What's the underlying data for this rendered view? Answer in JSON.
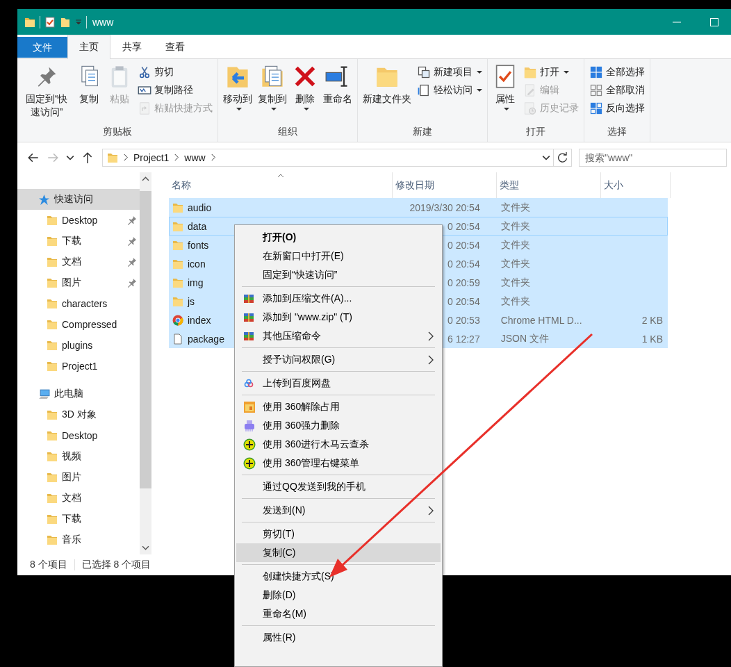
{
  "window": {
    "title": "www"
  },
  "ribbon_tabs": [
    {
      "label": "文件",
      "kind": "file",
      "selected": false
    },
    {
      "label": "主页",
      "kind": "tab",
      "selected": true
    },
    {
      "label": "共享",
      "kind": "tab",
      "selected": false
    },
    {
      "label": "查看",
      "kind": "tab",
      "selected": false
    }
  ],
  "ribbon_groups": [
    {
      "label": "剪贴板",
      "commands": [
        {
          "label": "固定到“快速访问”",
          "kind": "large",
          "disabled": false,
          "dropdown": false
        },
        {
          "label": "复制",
          "kind": "large",
          "disabled": false,
          "dropdown": false
        },
        {
          "label": "粘贴",
          "kind": "large",
          "disabled": true,
          "dropdown": false
        },
        {
          "label": "剪切",
          "kind": "small",
          "disabled": false,
          "dropdown": false
        },
        {
          "label": "复制路径",
          "kind": "small",
          "disabled": false,
          "dropdown": false
        },
        {
          "label": "粘贴快捷方式",
          "kind": "small",
          "disabled": true,
          "dropdown": false
        }
      ]
    },
    {
      "label": "组织",
      "commands": [
        {
          "label": "移动到",
          "kind": "large",
          "disabled": false,
          "dropdown": true
        },
        {
          "label": "复制到",
          "kind": "large",
          "disabled": false,
          "dropdown": true
        },
        {
          "label": "删除",
          "kind": "large",
          "disabled": false,
          "dropdown": true
        },
        {
          "label": "重命名",
          "kind": "large",
          "disabled": false,
          "dropdown": false
        }
      ]
    },
    {
      "label": "新建",
      "commands": [
        {
          "label": "新建文件夹",
          "kind": "large",
          "disabled": false,
          "dropdown": false
        },
        {
          "label": "新建项目",
          "kind": "small",
          "disabled": false,
          "dropdown": true
        },
        {
          "label": "轻松访问",
          "kind": "small",
          "disabled": false,
          "dropdown": true
        }
      ]
    },
    {
      "label": "打开",
      "commands": [
        {
          "label": "属性",
          "kind": "large",
          "disabled": false,
          "dropdown": true
        },
        {
          "label": "打开",
          "kind": "small",
          "disabled": false,
          "dropdown": true
        },
        {
          "label": "编辑",
          "kind": "small",
          "disabled": true,
          "dropdown": false
        },
        {
          "label": "历史记录",
          "kind": "small",
          "disabled": true,
          "dropdown": false
        }
      ]
    },
    {
      "label": "选择",
      "commands": [
        {
          "label": "全部选择",
          "kind": "small",
          "disabled": false,
          "dropdown": false
        },
        {
          "label": "全部取消",
          "kind": "small",
          "disabled": false,
          "dropdown": false
        },
        {
          "label": "反向选择",
          "kind": "small",
          "disabled": false,
          "dropdown": false
        }
      ]
    }
  ],
  "address_bar": {
    "breadcrumbs": [
      "Project1",
      "www"
    ],
    "search": {
      "placeholder": "搜索\"www\""
    }
  },
  "navigation": [
    {
      "label": "快速访问",
      "selected": true,
      "children": [
        {
          "label": "Desktop",
          "pinned": true,
          "selected": false
        },
        {
          "label": "下载",
          "pinned": true,
          "selected": false
        },
        {
          "label": "文档",
          "pinned": true,
          "selected": false
        },
        {
          "label": "图片",
          "pinned": true,
          "selected": false
        },
        {
          "label": "characters",
          "pinned": false,
          "selected": false
        },
        {
          "label": "Compressed",
          "pinned": false,
          "selected": false
        },
        {
          "label": "plugins",
          "pinned": false,
          "selected": false
        },
        {
          "label": "Project1",
          "pinned": false,
          "selected": false
        }
      ]
    },
    {
      "label": "此电脑",
      "selected": false,
      "children": [
        {
          "label": "3D 对象",
          "pinned": false,
          "selected": false
        },
        {
          "label": "Desktop",
          "pinned": false,
          "selected": false
        },
        {
          "label": "视频",
          "pinned": false,
          "selected": false
        },
        {
          "label": "图片",
          "pinned": false,
          "selected": false
        },
        {
          "label": "文档",
          "pinned": false,
          "selected": false
        },
        {
          "label": "下载",
          "pinned": false,
          "selected": false
        },
        {
          "label": "音乐",
          "pinned": false,
          "selected": false
        }
      ]
    }
  ],
  "file_list": {
    "columns": [
      {
        "label": "名称",
        "sorted": true
      },
      {
        "label": "修改日期",
        "sorted": false
      },
      {
        "label": "类型",
        "sorted": false
      },
      {
        "label": "大小",
        "sorted": false
      }
    ],
    "rows": [
      {
        "kind": "folder",
        "name": "audio",
        "date": "2019/3/30 20:54",
        "type": "文件夹",
        "size": "",
        "selected": true,
        "focused": false
      },
      {
        "kind": "folder",
        "name": "data",
        "date": "0 20:54",
        "type": "文件夹",
        "size": "",
        "selected": true,
        "focused": true
      },
      {
        "kind": "folder",
        "name": "fonts",
        "date": "0 20:54",
        "type": "文件夹",
        "size": "",
        "selected": true,
        "focused": false
      },
      {
        "kind": "folder",
        "name": "icon",
        "date": "0 20:54",
        "type": "文件夹",
        "size": "",
        "selected": true,
        "focused": false
      },
      {
        "kind": "folder",
        "name": "img",
        "date": "0 20:59",
        "type": "文件夹",
        "size": "",
        "selected": true,
        "focused": false
      },
      {
        "kind": "folder",
        "name": "js",
        "date": "0 20:54",
        "type": "文件夹",
        "size": "",
        "selected": true,
        "focused": false
      },
      {
        "kind": "chrome",
        "name": "index",
        "date": "0 20:53",
        "type": "Chrome HTML D...",
        "size": "2 KB",
        "selected": true,
        "focused": false
      },
      {
        "kind": "file",
        "name": "package",
        "date": "6 12:27",
        "type": "JSON 文件",
        "size": "1 KB",
        "selected": true,
        "focused": false
      }
    ]
  },
  "status_bar": {
    "item_count": "8 个项目",
    "selection": "已选择 8 个项目"
  },
  "context_menu": [
    [
      {
        "label": "打开(O)",
        "kind": "plain",
        "default": true,
        "submenu": false,
        "selected": false
      },
      {
        "label": "在新窗口中打开(E)",
        "kind": "plain",
        "default": false,
        "submenu": false,
        "selected": false
      },
      {
        "label": "固定到“快速访问”",
        "kind": "plain",
        "default": false,
        "submenu": false,
        "selected": false
      }
    ],
    [
      {
        "label": "添加到压缩文件(A)...",
        "kind": "archive",
        "default": false,
        "submenu": false,
        "selected": false
      },
      {
        "label": "添加到 \"www.zip\" (T)",
        "kind": "archive",
        "default": false,
        "submenu": false,
        "selected": false
      },
      {
        "label": "其他压缩命令",
        "kind": "archive",
        "default": false,
        "submenu": true,
        "selected": false
      }
    ],
    [
      {
        "label": "授予访问权限(G)",
        "kind": "plain",
        "default": false,
        "submenu": true,
        "selected": false
      }
    ],
    [
      {
        "label": "上传到百度网盘",
        "kind": "cloud",
        "default": false,
        "submenu": false,
        "selected": false
      }
    ],
    [
      {
        "label": "使用 360解除占用",
        "kind": "unlock",
        "default": false,
        "submenu": false,
        "selected": false
      },
      {
        "label": "使用 360强力删除",
        "kind": "shredder",
        "default": false,
        "submenu": false,
        "selected": false
      },
      {
        "label": "使用 360进行木马云查杀",
        "kind": "plus",
        "default": false,
        "submenu": false,
        "selected": false
      },
      {
        "label": "使用 360管理右键菜单",
        "kind": "plus",
        "default": false,
        "submenu": false,
        "selected": false
      }
    ],
    [
      {
        "label": "通过QQ发送到我的手机",
        "kind": "plain",
        "default": false,
        "submenu": false,
        "selected": false
      }
    ],
    [
      {
        "label": "发送到(N)",
        "kind": "plain",
        "default": false,
        "submenu": true,
        "selected": false
      }
    ],
    [
      {
        "label": "剪切(T)",
        "kind": "plain",
        "default": false,
        "submenu": false,
        "selected": false
      },
      {
        "label": "复制(C)",
        "kind": "plain",
        "default": false,
        "submenu": false,
        "selected": true
      }
    ],
    [
      {
        "label": "创建快捷方式(S)",
        "kind": "plain",
        "default": false,
        "submenu": false,
        "selected": false
      },
      {
        "label": "删除(D)",
        "kind": "plain",
        "default": false,
        "submenu": false,
        "selected": false
      },
      {
        "label": "重命名(M)",
        "kind": "plain",
        "default": false,
        "submenu": false,
        "selected": false
      }
    ],
    [
      {
        "label": "属性(R)",
        "kind": "plain",
        "default": false,
        "submenu": false,
        "selected": false
      }
    ]
  ]
}
